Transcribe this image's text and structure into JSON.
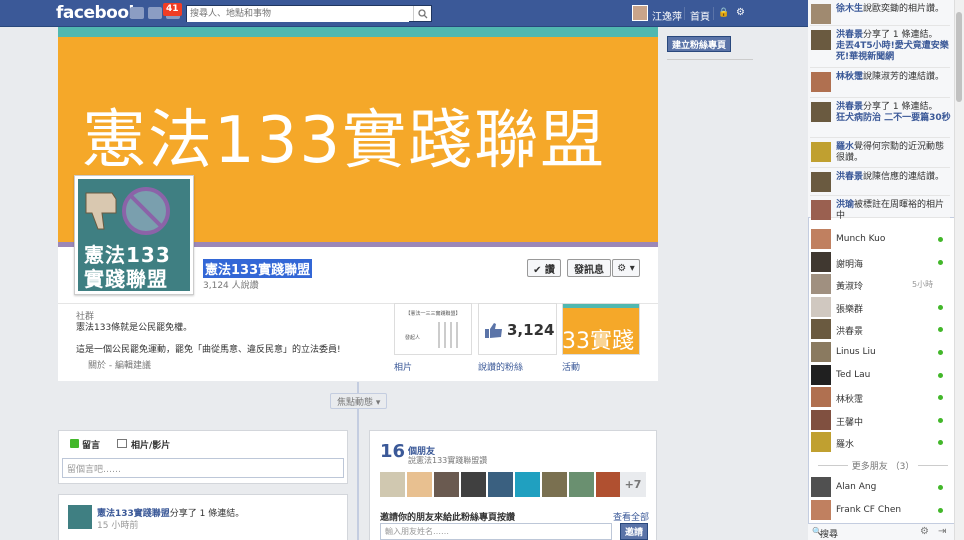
{
  "topbar": {
    "logo": "facebook",
    "notif_count": "41",
    "search_placeholder": "搜尋人、地點和事物",
    "user_name": "江逸萍",
    "home": "首頁"
  },
  "cover": {
    "title": "憲法133實踐聯盟",
    "profile_line1": "憲法133",
    "profile_line2": "實踐聯盟"
  },
  "page": {
    "name": "憲法133實踐聯盟",
    "likes_text": "3,124 人說讚",
    "like_btn": "✔ 讚",
    "message_btn": "發訊息",
    "gear_btn": "⚙ ▾"
  },
  "info": {
    "category": "社群",
    "line1": "憲法133條就是公民罷免權。",
    "line2": "這是一個公民罷免運動，罷免「曲從馬意、違反民意」的立法委員!",
    "links": "關於 - 編輯建議"
  },
  "tiles": {
    "photos_label": "相片",
    "likes_num": "3,124",
    "likes_label": "說讚的粉絲",
    "events_label": "活動",
    "events_text": "33實踐",
    "photos_doc_title": "【憲法一三三實踐聯盟】",
    "photos_doc_sign": "發起人"
  },
  "timeline": {
    "highlights": "焦點動態 ▾"
  },
  "composer": {
    "tab_post": "留言",
    "tab_photo": "相片/影片",
    "placeholder": "留個言吧……"
  },
  "story": {
    "author": "憲法133實踐聯盟",
    "action": "分享了 1 條連結。",
    "time": "15 小時前"
  },
  "friends": {
    "count": "16",
    "label": "個朋友",
    "sub": "說憲法133實踐聯盟讚",
    "more": "+7",
    "invite_title": "邀請你的朋友來給此粉絲專頁按讚",
    "see_all": "查看全部",
    "invite_placeholder": "輸入朋友姓名……",
    "invite_btn": "邀請"
  },
  "create_page": "建立粉絲專頁",
  "ticker": [
    {
      "name": "徐木生",
      "text": "說歐奕鋤的相片讚。",
      "color": "#a08a70"
    },
    {
      "name": "洪春景",
      "text": "分享了 1 條連結。",
      "extra": "走丟4T5小時!愛犬竟遭安樂死!華視新聞網",
      "color": "#6a5a40"
    },
    {
      "name": "林秋霪",
      "text": "說陳淑芳的連結讚。",
      "color": "#b07050"
    },
    {
      "name": "洪春景",
      "text": "分享了 1 條連結。",
      "extra": "狂犬病防治 二不一要篇30秒",
      "color": "#6a5a40"
    },
    {
      "name": "羅水",
      "text": "覺得何宗勳的近況動態很讚。",
      "color": "#c0a030"
    },
    {
      "name": "洪春景",
      "text": "說陳信應的連結讚。",
      "color": "#6a5a40"
    },
    {
      "name": "洪瑜",
      "text": "被標註在周暉裕的相片中",
      "color": "#9a6050"
    }
  ],
  "chat": [
    {
      "name": "Munch Kuo",
      "status": "online",
      "color": "#c08060"
    },
    {
      "name": "謝明海",
      "status": "online",
      "color": "#403830"
    },
    {
      "name": "黃淑玲",
      "status": "5小時",
      "color": "#a09080"
    },
    {
      "name": "張樂群",
      "status": "online",
      "color": "#d0c8c0"
    },
    {
      "name": "洪春景",
      "status": "online",
      "color": "#6a5a40"
    },
    {
      "name": "Linus Liu",
      "status": "online",
      "color": "#8a7a60"
    },
    {
      "name": "Ted Lau",
      "status": "online",
      "color": "#202020"
    },
    {
      "name": "林秋霪",
      "status": "online",
      "color": "#b07050"
    },
    {
      "name": "王馨中",
      "status": "online",
      "color": "#805040"
    },
    {
      "name": "羅水",
      "status": "online",
      "color": "#c0a030"
    }
  ],
  "more_friends": "更多朋友 （3）",
  "chat_more": [
    {
      "name": "Alan Ang",
      "status": "online",
      "color": "#505050"
    },
    {
      "name": "Frank CF Chen",
      "status": "online",
      "color": "#c08060"
    }
  ],
  "chat_search": "搜尋"
}
